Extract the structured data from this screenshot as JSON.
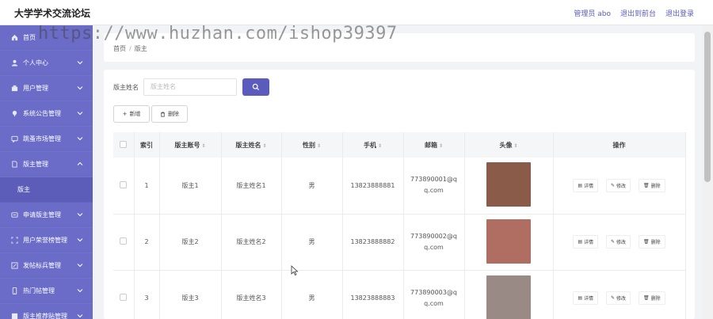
{
  "header": {
    "brand": "大学学术交流论坛",
    "links": [
      "管理员 abo",
      "退出到前台",
      "退出登录"
    ]
  },
  "watermark": "https://www.huzhan.com/ishop39397",
  "sidebar": {
    "items": [
      {
        "label": "首页",
        "icon": "home-icon",
        "expandable": false
      },
      {
        "label": "个人中心",
        "icon": "user-icon",
        "expandable": true
      },
      {
        "label": "用户管理",
        "icon": "building-icon",
        "expandable": true
      },
      {
        "label": "系统公告管理",
        "icon": "pin-icon",
        "expandable": true
      },
      {
        "label": "跳蚤市场管理",
        "icon": "chat-icon",
        "expandable": true
      },
      {
        "label": "版主管理",
        "icon": "document-icon",
        "expandable": true,
        "expanded": true
      },
      {
        "label": "版主",
        "sub": true
      },
      {
        "label": "申请版主管理",
        "icon": "card-icon",
        "expandable": true
      },
      {
        "label": "用户荣誉榜管理",
        "icon": "frame-icon",
        "expandable": true
      },
      {
        "label": "发帖标兵管理",
        "icon": "edit-icon",
        "expandable": true
      },
      {
        "label": "热门帖管理",
        "icon": "phone-icon",
        "expandable": true
      },
      {
        "label": "版主推荐贴管理",
        "icon": "list-icon",
        "expandable": true
      }
    ]
  },
  "breadcrumb": {
    "home": "首页",
    "current": "版主"
  },
  "search": {
    "label": "版主姓名",
    "placeholder": "版主姓名"
  },
  "toolbar": {
    "add_label": "新增",
    "delete_label": "删除"
  },
  "table": {
    "columns": [
      "",
      "索引",
      "版主账号",
      "版主姓名",
      "性别",
      "手机",
      "邮箱",
      "头像",
      "操作"
    ],
    "sortable": [
      false,
      false,
      true,
      true,
      true,
      true,
      true,
      true,
      false
    ],
    "rows": [
      {
        "index": "1",
        "account": "版主1",
        "name": "版主姓名1",
        "gender": "男",
        "phone": "13823888881",
        "email": "773890001@qq.com",
        "avatar_color": "#8a5b48"
      },
      {
        "index": "2",
        "account": "版主2",
        "name": "版主姓名2",
        "gender": "男",
        "phone": "13823888882",
        "email": "773890002@qq.com",
        "avatar_color": "#b06e63"
      },
      {
        "index": "3",
        "account": "版主3",
        "name": "版主姓名3",
        "gender": "男",
        "phone": "13823888883",
        "email": "773890003@qq.com",
        "avatar_color": "#9a8a86"
      }
    ],
    "row_actions": [
      "详情",
      "修改",
      "删除"
    ]
  },
  "colors": {
    "accent": "#5a5bbd",
    "sidebar": "#6a6cc8"
  }
}
